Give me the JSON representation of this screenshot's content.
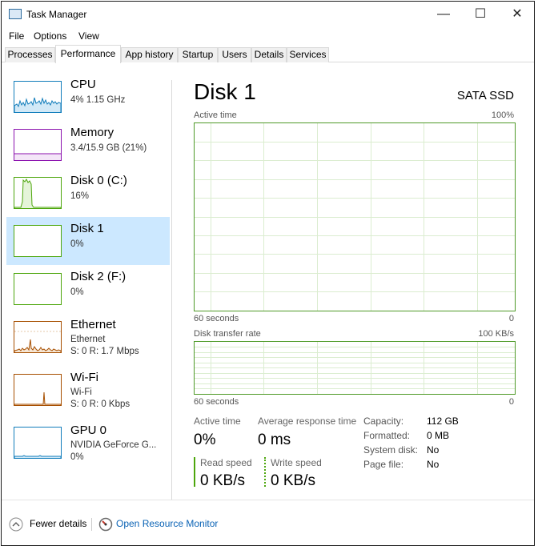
{
  "window": {
    "title": "Task Manager",
    "controls": {
      "minimize": "—",
      "maximize": "☐",
      "close": "✕"
    }
  },
  "menu": [
    "File",
    "Options",
    "View"
  ],
  "tabs": [
    {
      "label": "Processes"
    },
    {
      "label": "Performance",
      "active": true
    },
    {
      "label": "App history"
    },
    {
      "label": "Startup"
    },
    {
      "label": "Users"
    },
    {
      "label": "Details"
    },
    {
      "label": "Services"
    }
  ],
  "sidebar": {
    "items": [
      {
        "title": "CPU",
        "sub1": "4%  1.15 GHz",
        "color": "#117dbb",
        "icon": "cpu-usage-sparkline"
      },
      {
        "title": "Memory",
        "sub1": "3.4/15.9 GB (21%)",
        "color": "#8b12ae",
        "icon": "memory-usage-sparkline"
      },
      {
        "title": "Disk 0 (C:)",
        "sub1": "16%",
        "color": "#4da60c",
        "icon": "disk-usage-sparkline"
      },
      {
        "title": "Disk 1",
        "sub1": "0%",
        "color": "#4da60c",
        "selected": true,
        "icon": "disk-usage-sparkline"
      },
      {
        "title": "Disk 2 (F:)",
        "sub1": "0%",
        "color": "#4da60c",
        "icon": "disk-usage-sparkline"
      },
      {
        "title": "Ethernet",
        "sub1": "Ethernet",
        "sub2": "S: 0  R: 1.7 Mbps",
        "color": "#a74f01",
        "icon": "network-usage-sparkline"
      },
      {
        "title": "Wi-Fi",
        "sub1": "Wi-Fi",
        "sub2": "S: 0  R: 0 Kbps",
        "color": "#a74f01",
        "icon": "network-usage-sparkline"
      },
      {
        "title": "GPU 0",
        "sub1": "NVIDIA GeForce G...",
        "sub2": "0%",
        "color": "#117dbb",
        "icon": "gpu-usage-sparkline"
      }
    ]
  },
  "main": {
    "title": "Disk 1",
    "subtitle": "SATA SSD",
    "active_graph": {
      "label": "Active time",
      "max": "100%",
      "x_left": "60 seconds",
      "x_right": "0",
      "level": 0
    },
    "transfer_graph": {
      "label": "Disk transfer rate",
      "max": "100 KB/s",
      "x_left": "60 seconds",
      "x_right": "0",
      "level": 0
    },
    "stats": {
      "active_time_label": "Active time",
      "active_time_value": "0%",
      "avg_response_label": "Average response time",
      "avg_response_value": "0 ms",
      "read_label": "Read speed",
      "read_value": "0 KB/s",
      "write_label": "Write speed",
      "write_value": "0 KB/s"
    },
    "properties": [
      {
        "key": "Capacity:",
        "value": "112 GB"
      },
      {
        "key": "Formatted:",
        "value": "0 MB"
      },
      {
        "key": "System disk:",
        "value": "No"
      },
      {
        "key": "Page file:",
        "value": "No"
      }
    ],
    "accent": "#4da60c"
  },
  "footer": {
    "fewer_details": "Fewer details",
    "resource_monitor": "Open Resource Monitor",
    "link_color": "#0a63b5"
  }
}
